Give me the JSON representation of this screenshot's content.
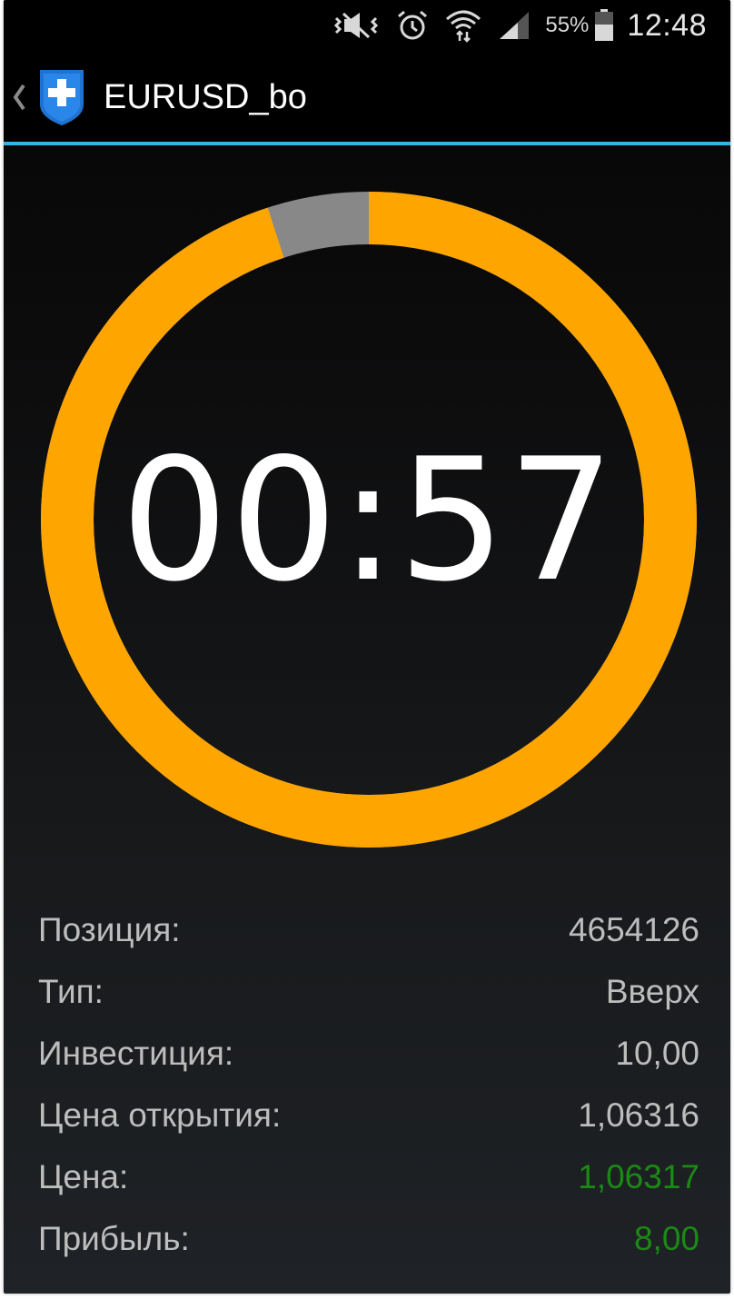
{
  "status_bar": {
    "icons": [
      "vibrate-mute-icon",
      "alarm-clock-icon",
      "wifi-data-icon",
      "cell-signal-icon",
      "battery-icon"
    ],
    "battery_percent": "55%",
    "time": "12:48"
  },
  "action_bar": {
    "back_icon": "chevron-left-icon",
    "logo_icon": "shield-plus-logo",
    "title": "EURUSD_bo"
  },
  "colors": {
    "accent_line": "#33b5e5",
    "ring_active": "#ffa500",
    "ring_elapsed": "#888888",
    "positive": "#1b8a14"
  },
  "timer": {
    "display": "00:57",
    "remaining_fraction": 0.95
  },
  "details": [
    {
      "label": "Позиция:",
      "value": "4654126",
      "highlight": false
    },
    {
      "label": "Тип:",
      "value": "Вверх",
      "highlight": false
    },
    {
      "label": "Инвестиция:",
      "value": "10,00",
      "highlight": false
    },
    {
      "label": "Цена открытия:",
      "value": "1,06316",
      "highlight": false
    },
    {
      "label": "Цена:",
      "value": "1,06317",
      "highlight": true
    },
    {
      "label": "Прибыль:",
      "value": "8,00",
      "highlight": true
    }
  ]
}
